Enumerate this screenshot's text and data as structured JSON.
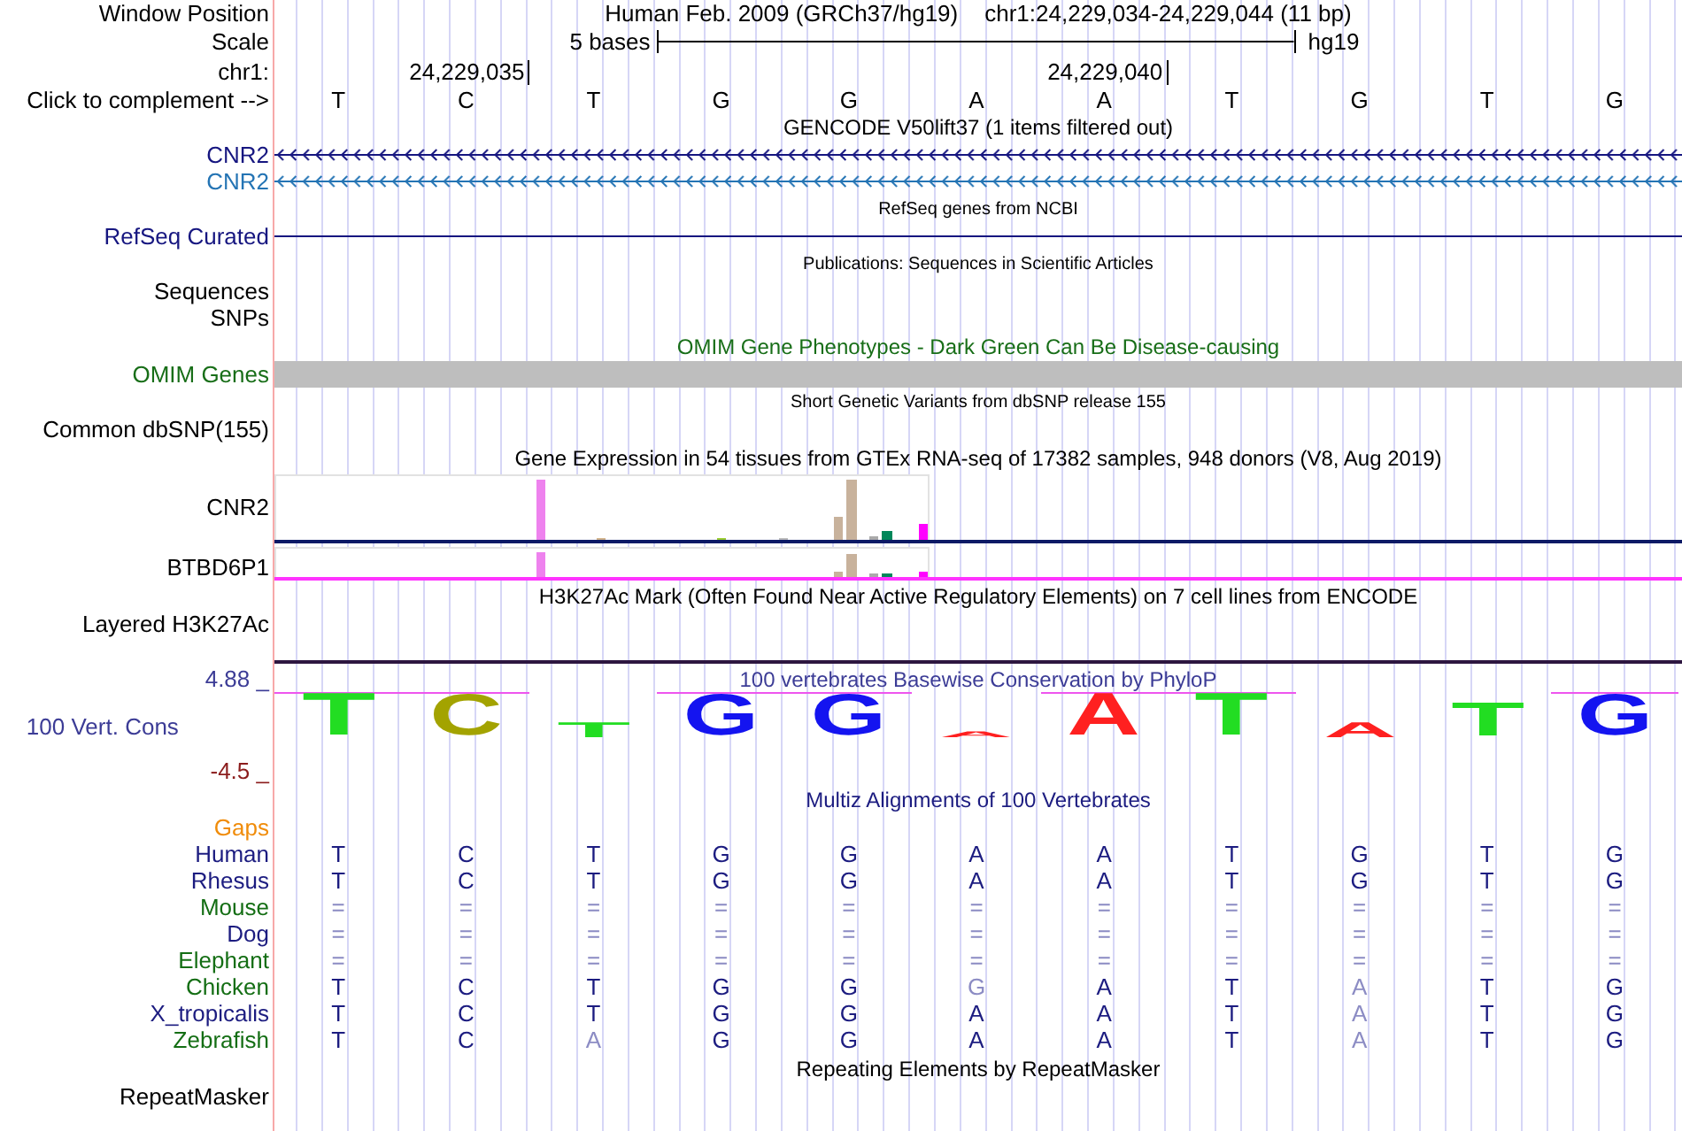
{
  "position": {
    "label": "Window Position",
    "assembly": "Human Feb. 2009 (GRCh37/hg19)",
    "range": "chr1:24,229,034-24,229,044 (11 bp)"
  },
  "scale": {
    "label": "Scale",
    "length": "5 bases",
    "assembly": "hg19"
  },
  "ruler": {
    "label": "chr1:"
  },
  "sequence": {
    "label": "Click to complement -->",
    "bases": [
      {
        "base": "T"
      },
      {
        "base": "C",
        "tick": "24,229,035"
      },
      {
        "base": "T"
      },
      {
        "base": "G"
      },
      {
        "base": "G"
      },
      {
        "base": "A"
      },
      {
        "base": "A",
        "tick": "24,229,040"
      },
      {
        "base": "T"
      },
      {
        "base": "G"
      },
      {
        "base": "T"
      },
      {
        "base": "G"
      }
    ]
  },
  "tracks": [
    {
      "kind": "genes",
      "title": "GENCODE V50lift37 (1 items filtered out)",
      "genes": [
        {
          "label": "CNR2",
          "color": "#161680",
          "reverse": true
        },
        {
          "label": "CNR2",
          "color": "#2474b4",
          "reverse": true
        }
      ]
    },
    {
      "kind": "genes",
      "caption": "RefSeq genes from NCBI",
      "genes": [
        {
          "label": "RefSeq Curated",
          "color": "#161680"
        }
      ]
    },
    {
      "kind": "empty",
      "caption": "Publications: Sequences in Scientific Articles",
      "labels": [
        "Sequences",
        "SNPs"
      ]
    },
    {
      "kind": "bar",
      "title": "OMIM Gene Phenotypes - Dark Green Can Be Disease-causing",
      "label": "OMIM Genes",
      "color": "#186e18"
    },
    {
      "kind": "empty",
      "caption": "Short Genetic Variants from dbSNP release 155",
      "labels": [
        "Common dbSNP(155)"
      ]
    },
    {
      "kind": "expression",
      "title": "Gene Expression in 54 tissues from GTEx RNA-seq of 17382 samples, 948 donors (V8, Aug 2019)",
      "genes": [
        {
          "label": "CNR2",
          "color": "#0c1a66"
        },
        {
          "label": "BTBD6P1",
          "color": "#ff33ff"
        }
      ]
    },
    {
      "kind": "signal",
      "title": "H3K27Ac Mark (Often Found Near Active Regulatory Elements) on 7 cell lines from ENCODE",
      "label": "Layered H3K27Ac"
    },
    {
      "kind": "conservation",
      "title": "100 vertebrates Basewise Conservation by PhyloP",
      "label": "100 Vert. Cons",
      "axis_max": "4.88 _",
      "axis_min": "-4.5 _",
      "color": "#3c3c96",
      "logo": [
        {
          "base": "T",
          "color": "#22dd22"
        },
        {
          "base": "C",
          "color": "#a3a300"
        },
        {
          "base": "T",
          "color": "#22dd22"
        },
        {
          "base": "G",
          "color": "#1414f0"
        },
        {
          "base": "G",
          "color": "#1414f0"
        },
        {
          "base": "A",
          "color": "#ff2020"
        },
        {
          "base": "A",
          "color": "#ff2020"
        },
        {
          "base": "T",
          "color": "#22dd22"
        },
        {
          "base": "A",
          "color": "#ff2020"
        },
        {
          "base": "T",
          "color": "#22dd22"
        },
        {
          "base": "G",
          "color": "#1414f0"
        }
      ]
    },
    {
      "kind": "alignment",
      "title": "Multiz Alignments of 100 Vertebrates",
      "color": "#1c1c80",
      "rows": [
        {
          "kind": "gaps",
          "name": "Gaps",
          "color": "#f08c0a"
        },
        {
          "kind": "species",
          "name": "Human",
          "color": "#1c1c80",
          "bases": [
            {
              "base": "T",
              "dim": false
            },
            {
              "base": "C",
              "dim": false
            },
            {
              "base": "T",
              "dim": false
            },
            {
              "base": "G",
              "dim": false
            },
            {
              "base": "G",
              "dim": false
            },
            {
              "base": "A",
              "dim": false
            },
            {
              "base": "A",
              "dim": false
            },
            {
              "base": "T",
              "dim": false
            },
            {
              "base": "G",
              "dim": false
            },
            {
              "base": "T",
              "dim": false
            },
            {
              "base": "G",
              "dim": false
            }
          ]
        },
        {
          "kind": "species",
          "name": "Rhesus",
          "color": "#1c1c80",
          "bases": [
            {
              "base": "T",
              "dim": false
            },
            {
              "base": "C",
              "dim": false
            },
            {
              "base": "T",
              "dim": false
            },
            {
              "base": "G",
              "dim": false
            },
            {
              "base": "G",
              "dim": false
            },
            {
              "base": "A",
              "dim": false
            },
            {
              "base": "A",
              "dim": false
            },
            {
              "base": "T",
              "dim": false
            },
            {
              "base": "G",
              "dim": false
            },
            {
              "base": "T",
              "dim": false
            },
            {
              "base": "G",
              "dim": false
            }
          ]
        },
        {
          "kind": "species",
          "name": "Mouse",
          "color": "#146e14",
          "bases": [
            {
              "base": "=",
              "dim": true
            },
            {
              "base": "=",
              "dim": true
            },
            {
              "base": "=",
              "dim": true
            },
            {
              "base": "=",
              "dim": true
            },
            {
              "base": "=",
              "dim": true
            },
            {
              "base": "=",
              "dim": true
            },
            {
              "base": "=",
              "dim": true
            },
            {
              "base": "=",
              "dim": true
            },
            {
              "base": "=",
              "dim": true
            },
            {
              "base": "=",
              "dim": true
            },
            {
              "base": "=",
              "dim": true
            }
          ]
        },
        {
          "kind": "species",
          "name": "Dog",
          "color": "#1c1c80",
          "bases": [
            {
              "base": "=",
              "dim": true
            },
            {
              "base": "=",
              "dim": true
            },
            {
              "base": "=",
              "dim": true
            },
            {
              "base": "=",
              "dim": true
            },
            {
              "base": "=",
              "dim": true
            },
            {
              "base": "=",
              "dim": true
            },
            {
              "base": "=",
              "dim": true
            },
            {
              "base": "=",
              "dim": true
            },
            {
              "base": "=",
              "dim": true
            },
            {
              "base": "=",
              "dim": true
            },
            {
              "base": "=",
              "dim": true
            }
          ]
        },
        {
          "kind": "species",
          "name": "Elephant",
          "color": "#146e14",
          "bases": [
            {
              "base": "=",
              "dim": true
            },
            {
              "base": "=",
              "dim": true
            },
            {
              "base": "=",
              "dim": true
            },
            {
              "base": "=",
              "dim": true
            },
            {
              "base": "=",
              "dim": true
            },
            {
              "base": "=",
              "dim": true
            },
            {
              "base": "=",
              "dim": true
            },
            {
              "base": "=",
              "dim": true
            },
            {
              "base": "=",
              "dim": true
            },
            {
              "base": "=",
              "dim": true
            },
            {
              "base": "=",
              "dim": true
            }
          ]
        },
        {
          "kind": "species",
          "name": "Chicken",
          "color": "#146e14",
          "bases": [
            {
              "base": "T",
              "dim": false
            },
            {
              "base": "C",
              "dim": false
            },
            {
              "base": "T",
              "dim": false
            },
            {
              "base": "G",
              "dim": false
            },
            {
              "base": "G",
              "dim": false
            },
            {
              "base": "G",
              "dim": true
            },
            {
              "base": "A",
              "dim": false
            },
            {
              "base": "T",
              "dim": false
            },
            {
              "base": "A",
              "dim": true
            },
            {
              "base": "T",
              "dim": false
            },
            {
              "base": "G",
              "dim": false
            }
          ]
        },
        {
          "kind": "species",
          "name": "X_tropicalis",
          "color": "#1c1c80",
          "bases": [
            {
              "base": "T",
              "dim": false
            },
            {
              "base": "C",
              "dim": false
            },
            {
              "base": "T",
              "dim": false
            },
            {
              "base": "G",
              "dim": false
            },
            {
              "base": "G",
              "dim": false
            },
            {
              "base": "A",
              "dim": false
            },
            {
              "base": "A",
              "dim": false
            },
            {
              "base": "T",
              "dim": false
            },
            {
              "base": "A",
              "dim": true
            },
            {
              "base": "T",
              "dim": false
            },
            {
              "base": "G",
              "dim": false
            }
          ]
        },
        {
          "kind": "species",
          "name": "Zebrafish",
          "color": "#146e14",
          "bases": [
            {
              "base": "T",
              "dim": false
            },
            {
              "base": "C",
              "dim": false
            },
            {
              "base": "A",
              "dim": true
            },
            {
              "base": "G",
              "dim": false
            },
            {
              "base": "G",
              "dim": false
            },
            {
              "base": "A",
              "dim": false
            },
            {
              "base": "A",
              "dim": false
            },
            {
              "base": "T",
              "dim": false
            },
            {
              "base": "A",
              "dim": true
            },
            {
              "base": "T",
              "dim": false
            },
            {
              "base": "G",
              "dim": false
            }
          ]
        }
      ]
    },
    {
      "kind": "empty",
      "title": "Repeating Elements by RepeatMasker",
      "labels": [
        "RepeatMasker"
      ]
    }
  ]
}
